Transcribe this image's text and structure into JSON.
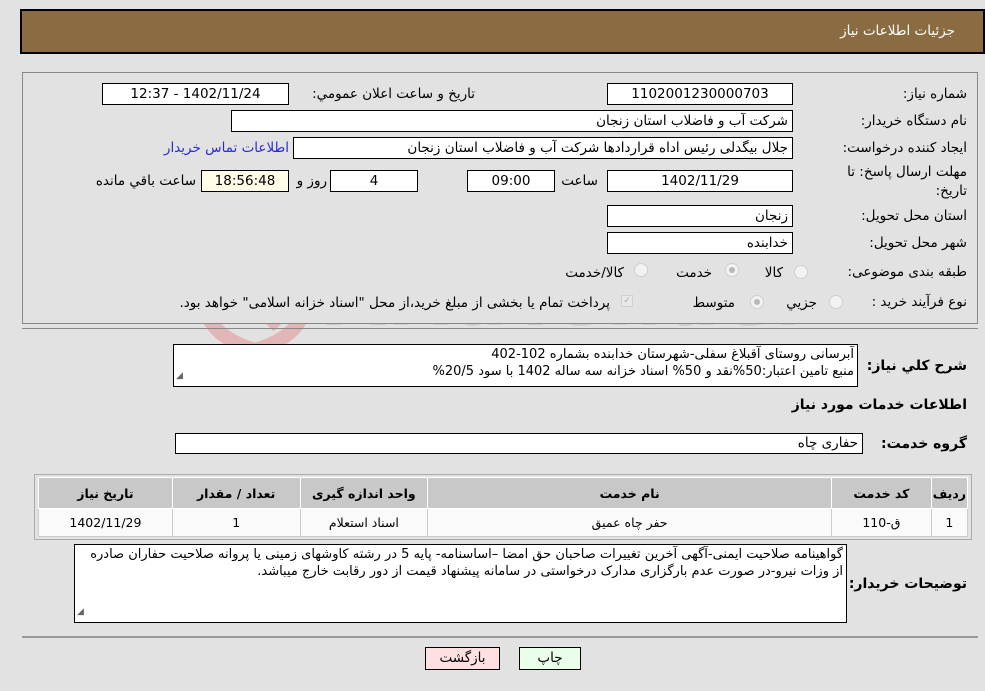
{
  "header": {
    "title": "جزئیات اطلاعات نیاز"
  },
  "form": {
    "need_number_label": "شماره نیاز:",
    "need_number": "1102001230000703",
    "announce_label": "تاریخ و ساعت اعلان عمومي:",
    "announce_value": "1402/11/24 - 12:37",
    "buyer_org_label": "نام دستگاه خریدار:",
    "buyer_org": "شرکت آب و فاضلاب استان زنجان",
    "creator_label": "ایجاد کننده درخواست:",
    "creator": "جلال بیگدلی رئیس اداه قراردادها شرکت آب و فاضلاب استان زنجان",
    "contact_link": "اطلاعات تماس خریدار",
    "deadline_label_1": "مهلت ارسال پاسخ: تا",
    "deadline_label_2": "تاریخ:",
    "deadline_date": "1402/11/29",
    "time_label": "ساعت",
    "deadline_time": "09:00",
    "days_value": "4",
    "days_label": "روز و",
    "remaining_time": "18:56:48",
    "remaining_label": "ساعت باقي مانده",
    "province_label": "استان محل تحویل:",
    "province": "زنجان",
    "city_label": "شهر محل تحویل:",
    "city": "خدابنده",
    "category_label": "طبقه بندی موضوعی:",
    "category_options": [
      {
        "label": "کالا",
        "checked": false
      },
      {
        "label": "خدمت",
        "checked": true
      },
      {
        "label": "کالا/خدمت",
        "checked": false
      }
    ],
    "process_label": "نوع فرآیند خرید :",
    "process_options": [
      {
        "label": "جزيي",
        "checked": false
      },
      {
        "label": "متوسط",
        "checked": true
      }
    ],
    "treasury_checkbox_label": "پرداخت تمام یا بخشی از مبلغ خرید،از محل \"اسناد خزانه اسلامی\" خواهد بود.",
    "treasury_checked": true
  },
  "description": {
    "label": "شرح کلي نیاز:",
    "line1": "آبرسانی روستای آقبلاغ سفلی-شهرستان خدابنده بشماره 102-402",
    "line2": "منبع تامین اعتبار:50%نقد و 50% اسناد خزانه سه ساله 1402 با سود 20/5%"
  },
  "services_section": {
    "title": "اطلاعات خدمات مورد نیاز",
    "group_label": "گروه خدمت:",
    "group_value": "حفاری چاه"
  },
  "table": {
    "headers": [
      "ردیف",
      "کد خدمت",
      "نام خدمت",
      "واحد اندازه گیری",
      "تعداد / مقدار",
      "تاریخ نیاز"
    ],
    "rows": [
      [
        "1",
        "ق-110",
        "حفر چاه عمیق",
        "اسناد استعلام",
        "1",
        "1402/11/29"
      ]
    ]
  },
  "buyer_notes": {
    "label": "توضیحات خریدار:",
    "text": "گواهینامه صلاحیت ایمنی-آگهی آخرین تغییرات صاحبان حق امضا –اساسنامه- پایه 5 در رشته کاوشهای زمینی یا پروانه صلاحیت حفاران صادره از وزات نیرو-در صورت عدم بارگزاری مدارک درخواستی در سامانه پیشنهاد قیمت از دور رقابت خارج میباشد."
  },
  "buttons": {
    "print": "چاپ",
    "back": "بازگشت"
  },
  "colors": {
    "header": "#8b6c42",
    "print_bg": "#eaffea",
    "back_bg": "#ffe0e0",
    "link": "#2b2bd6"
  }
}
